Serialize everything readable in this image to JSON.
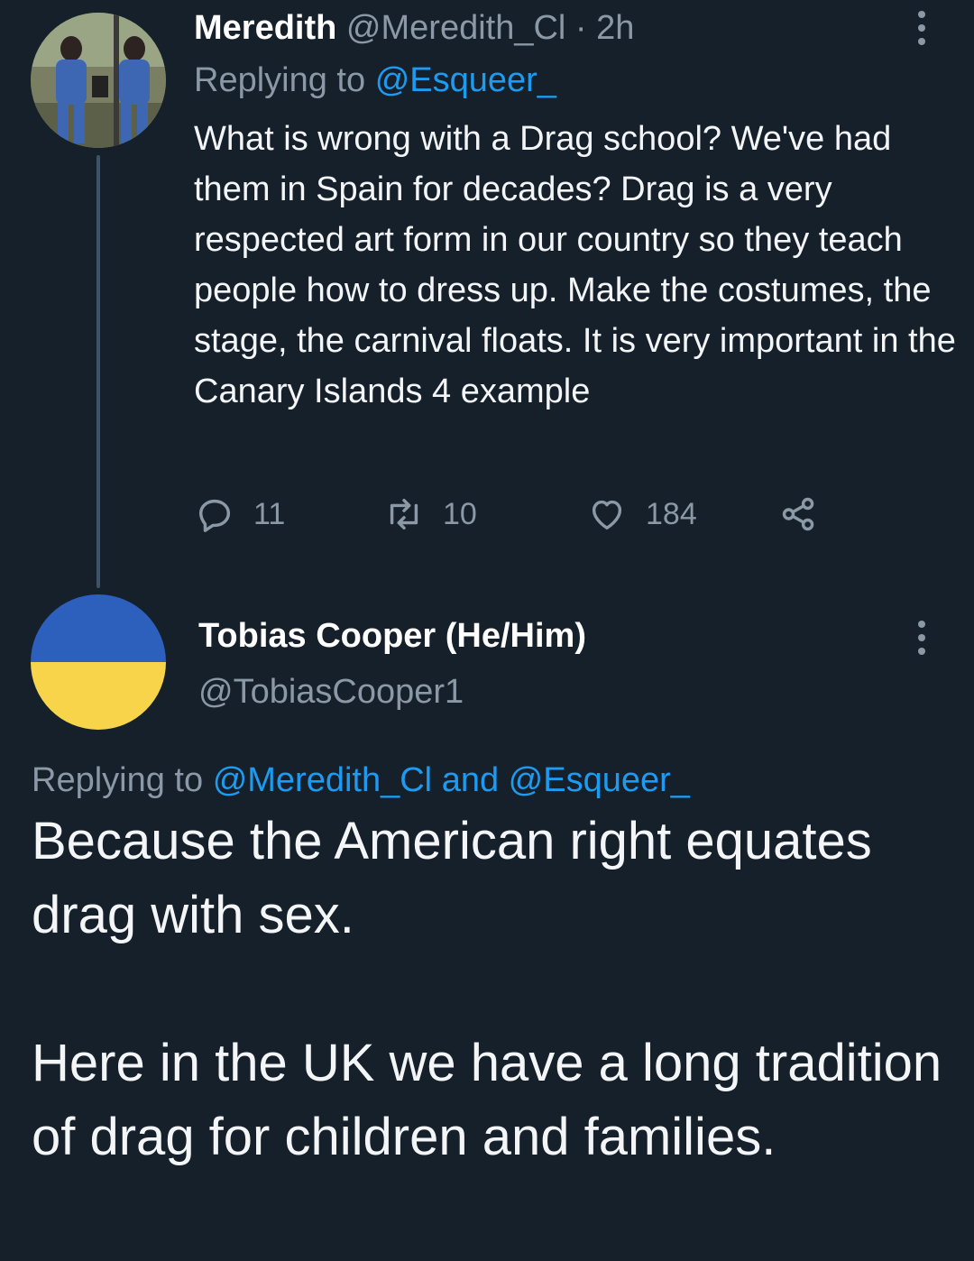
{
  "tweet1": {
    "display_name": "Meredith",
    "handle": "@Meredith_Cl",
    "separator": "·",
    "time": "2h",
    "replying_prefix": "Replying to",
    "replying_to": "@Esqueer_",
    "text": "What is wrong with a Drag school? We've had them in Spain for decades? Drag is a very respected art form in our country so they teach people how to dress up. Make the costumes, the stage, the carnival floats. It is very important in the Canary Islands 4 example",
    "replies": "11",
    "retweets": "10",
    "likes": "184"
  },
  "tweet2": {
    "display_name": "Tobias Cooper (He/Him)",
    "handle": "@TobiasCooper1",
    "replying_prefix": "Replying to",
    "replying_to_1": "@Meredith_Cl",
    "replying_and": "and",
    "replying_to_2": "@Esqueer_",
    "text": "Because the American right equates drag with sex.\n\nHere in the UK we have a long tradition of drag for children and families.",
    "avatar_colors": {
      "top": "#2d5fbd",
      "bottom": "#f7d44a"
    }
  },
  "colors": {
    "background": "#15202b",
    "link": "#1d9bf0",
    "secondary_text": "#8b98a5",
    "thread_line": "#3d5466"
  },
  "icons": [
    "reply-icon",
    "retweet-icon",
    "like-icon",
    "share-icon",
    "more-icon"
  ]
}
